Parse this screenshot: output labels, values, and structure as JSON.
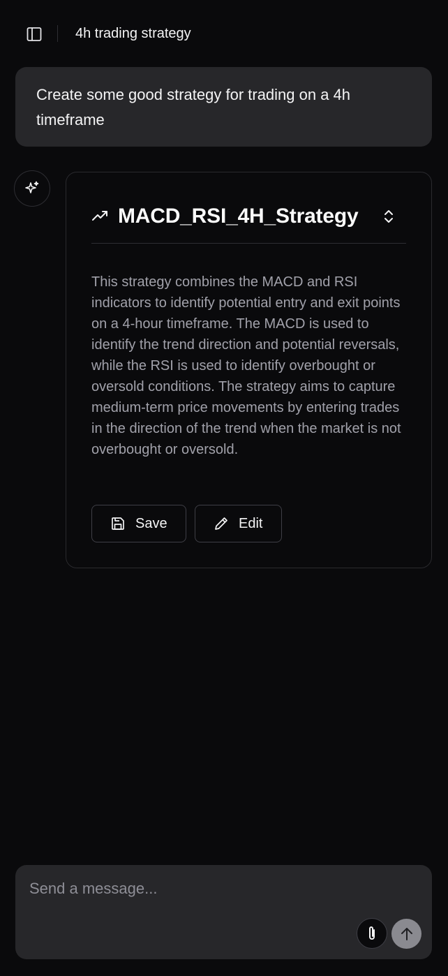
{
  "header": {
    "title": "4h trading strategy",
    "sidebar_toggle_icon": "sidebar-icon"
  },
  "messages": {
    "user": "Create some good strategy for trading on a 4h timeframe",
    "assistant_icon": "sparkles-icon"
  },
  "strategy_card": {
    "icon": "trending-up-icon",
    "title": "MACD_RSI_4H_Strategy",
    "expand_icon": "chevrons-up-down-icon",
    "description": "This strategy combines the MACD and RSI indicators to identify potential entry and exit points on a 4-hour timeframe. The MACD is used to identify the trend direction and potential reversals, while the RSI is used to identify overbought or oversold conditions. The strategy aims to capture medium-term price movements by entering trades in the direction of the trend when the market is not overbought or oversold.",
    "save_label": "Save",
    "save_icon": "save-icon",
    "edit_label": "Edit",
    "edit_icon": "pencil-icon"
  },
  "composer": {
    "placeholder": "Send a message...",
    "value": "",
    "attach_icon": "paperclip-icon",
    "send_icon": "arrow-up-icon"
  },
  "colors": {
    "background": "#0a0a0c",
    "bubble": "#27272a",
    "muted_text": "#a1a1aa",
    "border": "#2a2a2e",
    "send_button": "#8a8a90"
  }
}
